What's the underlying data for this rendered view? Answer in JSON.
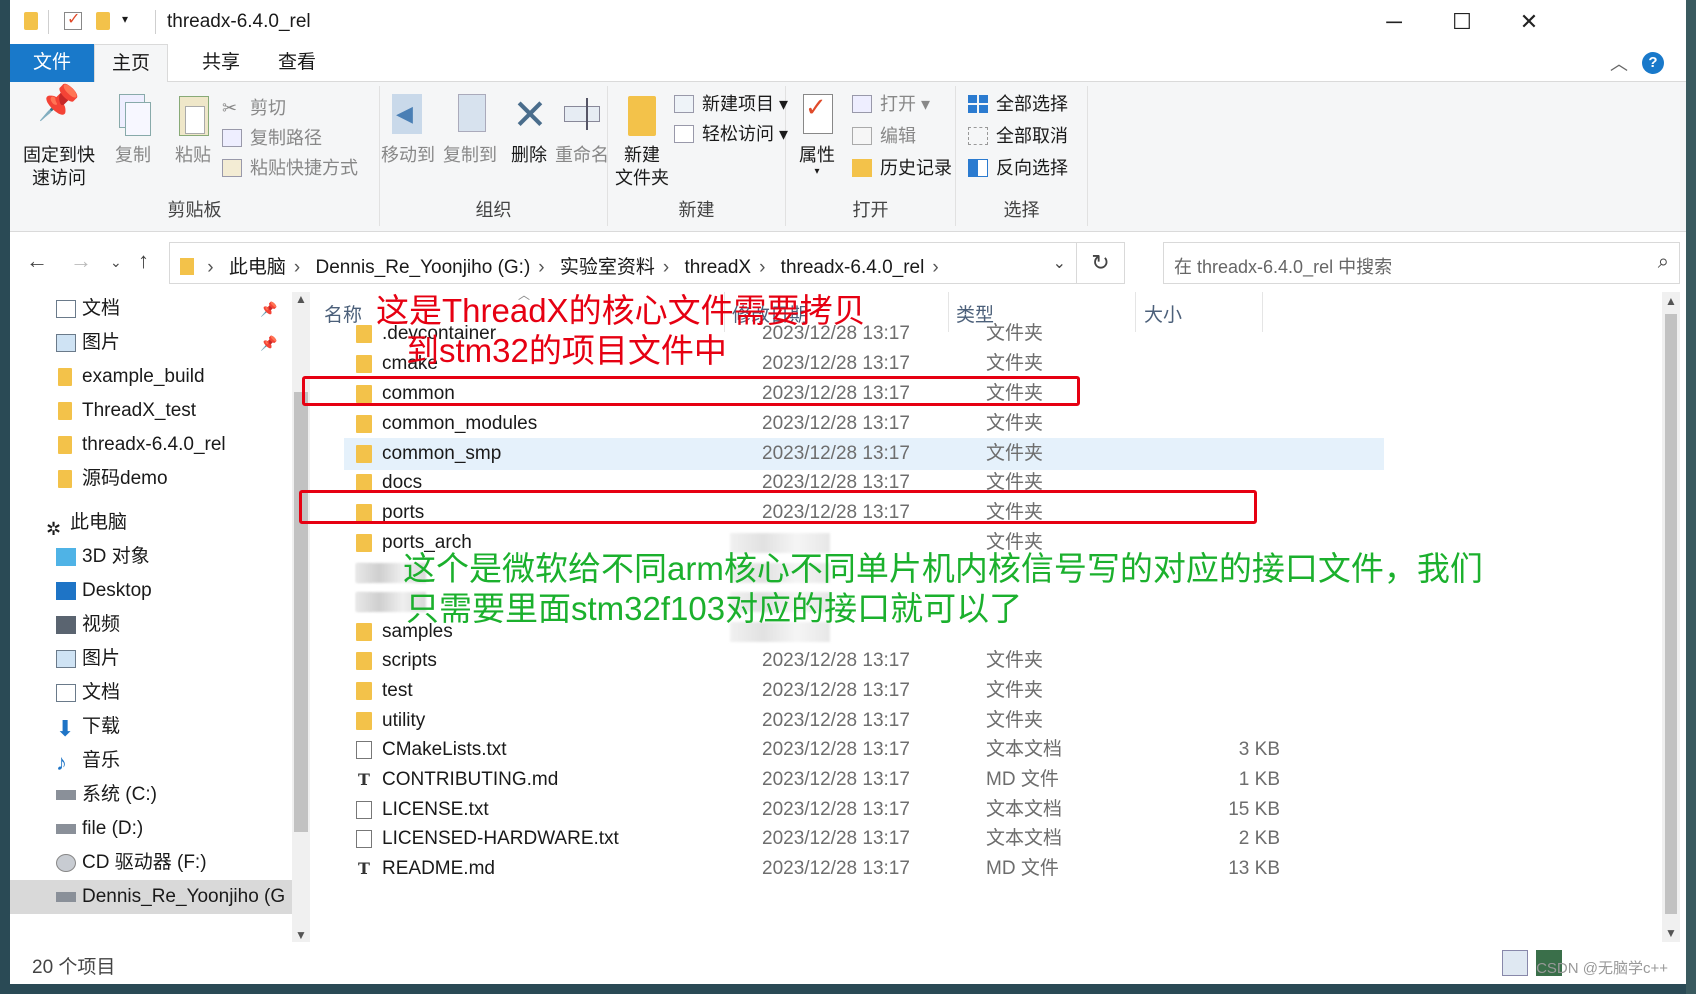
{
  "window": {
    "title": "threadx-6.4.0_rel",
    "minimize": "─",
    "maximize": "☐",
    "close": "✕"
  },
  "tabs": {
    "file": "文件",
    "home": "主页",
    "share": "共享",
    "view": "查看"
  },
  "ribbon": {
    "clipboard": {
      "label": "剪贴板",
      "pin": "固定到快速访问",
      "pin_line1": "固定到快",
      "pin_line2": "速访问",
      "copy": "复制",
      "paste": "粘贴",
      "cut": "剪切",
      "copy_path": "复制路径",
      "paste_shortcut": "粘贴快捷方式"
    },
    "organize": {
      "label": "组织",
      "move_to": "移动到",
      "copy_to": "复制到",
      "delete": "删除",
      "rename": "重命名"
    },
    "new": {
      "label": "新建",
      "new_folder_line1": "新建",
      "new_folder_line2": "文件夹",
      "new_item": "新建项目",
      "easy_access": "轻松访问"
    },
    "open": {
      "label": "打开",
      "properties": "属性",
      "open": "打开",
      "edit": "编辑",
      "history": "历史记录"
    },
    "select": {
      "label": "选择",
      "select_all": "全部选择",
      "select_none": "全部取消",
      "invert": "反向选择"
    }
  },
  "address": {
    "crumbs": [
      "此电脑",
      "Dennis_Re_Yoonjiho (G:)",
      "实验室资料",
      "threadX",
      "threadx-6.4.0_rel"
    ],
    "search_placeholder": "在 threadx-6.4.0_rel 中搜索"
  },
  "nav": {
    "quick": [
      {
        "label": "文档",
        "icon": "document-icon",
        "pinned": true
      },
      {
        "label": "图片",
        "icon": "pictures-icon",
        "pinned": true
      },
      {
        "label": "example_build",
        "icon": "folder-icon"
      },
      {
        "label": "ThreadX_test",
        "icon": "folder-icon"
      },
      {
        "label": "threadx-6.4.0_rel",
        "icon": "folder-icon"
      },
      {
        "label": "源码demo",
        "icon": "folder-icon"
      }
    ],
    "this_pc": "此电脑",
    "pc_items": [
      {
        "label": "3D 对象",
        "icon": "3d-objects-icon"
      },
      {
        "label": "Desktop",
        "icon": "desktop-icon"
      },
      {
        "label": "视频",
        "icon": "video-icon"
      },
      {
        "label": "图片",
        "icon": "pictures-icon"
      },
      {
        "label": "文档",
        "icon": "document-icon"
      },
      {
        "label": "下载",
        "icon": "download-icon"
      },
      {
        "label": "音乐",
        "icon": "music-icon"
      },
      {
        "label": "系统 (C:)",
        "icon": "drive-icon"
      },
      {
        "label": "file (D:)",
        "icon": "drive-icon"
      },
      {
        "label": "CD 驱动器 (F:)",
        "icon": "cd-drive-icon"
      },
      {
        "label": "Dennis_Re_Yoonjiho (G",
        "icon": "drive-icon"
      }
    ]
  },
  "columns": {
    "name": "名称",
    "date": "修改日期",
    "type": "类型",
    "size": "大小"
  },
  "files": [
    {
      "name": ".devcontainer",
      "date": "2023/12/28 13:17",
      "type": "文件夹",
      "size": "",
      "kind": "folder"
    },
    {
      "name": "cmake",
      "date": "2023/12/28 13:17",
      "type": "文件夹",
      "size": "",
      "kind": "folder"
    },
    {
      "name": "common",
      "date": "2023/12/28 13:17",
      "type": "文件夹",
      "size": "",
      "kind": "folder"
    },
    {
      "name": "common_modules",
      "date": "2023/12/28 13:17",
      "type": "文件夹",
      "size": "",
      "kind": "folder"
    },
    {
      "name": "common_smp",
      "date": "2023/12/28 13:17",
      "type": "文件夹",
      "size": "",
      "kind": "folder"
    },
    {
      "name": "docs",
      "date": "2023/12/28 13:17",
      "type": "文件夹",
      "size": "",
      "kind": "folder"
    },
    {
      "name": "ports",
      "date": "2023/12/28 13:17",
      "type": "文件夹",
      "size": "",
      "kind": "folder"
    },
    {
      "name": "ports_arch",
      "date": "",
      "type": "文件夹",
      "size": "",
      "kind": "folder"
    },
    {
      "name": "",
      "date": "",
      "type": "",
      "size": "",
      "kind": "blurred"
    },
    {
      "name": "",
      "date": "",
      "type": "",
      "size": "",
      "kind": "blurred"
    },
    {
      "name": "samples",
      "date": "",
      "type": "",
      "size": "",
      "kind": "folder"
    },
    {
      "name": "scripts",
      "date": "2023/12/28 13:17",
      "type": "文件夹",
      "size": "",
      "kind": "folder"
    },
    {
      "name": "test",
      "date": "2023/12/28 13:17",
      "type": "文件夹",
      "size": "",
      "kind": "folder"
    },
    {
      "name": "utility",
      "date": "2023/12/28 13:17",
      "type": "文件夹",
      "size": "",
      "kind": "folder"
    },
    {
      "name": "CMakeLists.txt",
      "date": "2023/12/28 13:17",
      "type": "文本文档",
      "size": "3 KB",
      "kind": "txt"
    },
    {
      "name": "CONTRIBUTING.md",
      "date": "2023/12/28 13:17",
      "type": "MD 文件",
      "size": "1 KB",
      "kind": "md"
    },
    {
      "name": "LICENSE.txt",
      "date": "2023/12/28 13:17",
      "type": "文本文档",
      "size": "15 KB",
      "kind": "txt"
    },
    {
      "name": "LICENSED-HARDWARE.txt",
      "date": "2023/12/28 13:17",
      "type": "文本文档",
      "size": "2 KB",
      "kind": "txt"
    },
    {
      "name": "README.md",
      "date": "2023/12/28 13:17",
      "type": "MD 文件",
      "size": "13 KB",
      "kind": "md"
    }
  ],
  "status": {
    "count": "20 个项目"
  },
  "annotations": {
    "red_line1": "这是ThreadX的核心文件需要拷贝",
    "red_line2": "到stm32的项目文件中",
    "green_line1": "这个是微软给不同arm核心不同单片机内核信号写的对应的接口文件，我们",
    "green_line2": "只需要里面stm32f103对应的接口就可以了"
  },
  "watermark": "CSDN @无脑学c++",
  "colors": {
    "accent": "#1979ca",
    "annotation_red": "#e60012",
    "annotation_green": "#1bb02d",
    "folder": "#f3c24a",
    "selection": "#e5f1fb"
  }
}
